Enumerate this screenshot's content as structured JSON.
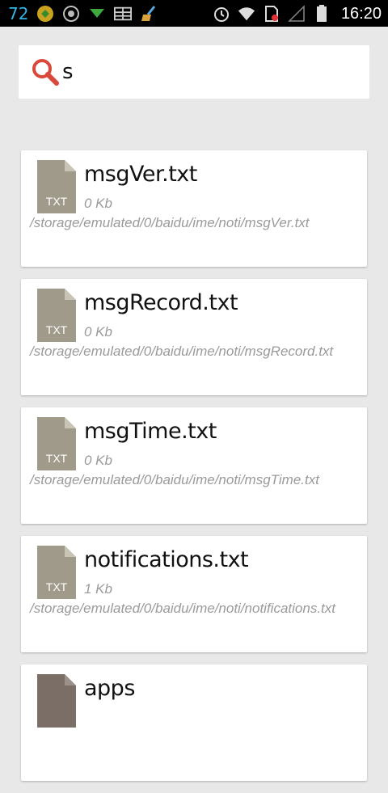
{
  "status_bar": {
    "battery_number": "72",
    "time": "16:20",
    "icons_left": [
      "circle-logo-icon",
      "target-icon",
      "download-icon",
      "grid-icon",
      "broom-icon"
    ],
    "icons_right": [
      "alarm-icon",
      "wifi-icon",
      "sim-icon",
      "signal-icon",
      "battery-icon"
    ],
    "colors": {
      "battery_number": "#33b5e5"
    }
  },
  "search": {
    "query": "s",
    "icon": "search-icon",
    "icon_color": "#d9483b"
  },
  "files": [
    {
      "name": "msgVer.txt",
      "size": "0 Kb",
      "path": "/storage/emulated/0/baidu/ime/noti/msgVer.txt",
      "type_label": "TXT"
    },
    {
      "name": "msgRecord.txt",
      "size": "0 Kb",
      "path": "/storage/emulated/0/baidu/ime/noti/msgRecord.txt",
      "type_label": "TXT"
    },
    {
      "name": "msgTime.txt",
      "size": "0 Kb",
      "path": "/storage/emulated/0/baidu/ime/noti/msgTime.txt",
      "type_label": "TXT"
    },
    {
      "name": "notifications.txt",
      "size": "1 Kb",
      "path": "/storage/emulated/0/baidu/ime/noti/notifications.txt",
      "type_label": "TXT"
    },
    {
      "name": "apps",
      "size": "",
      "path": "",
      "type_label": ""
    }
  ],
  "colors": {
    "background": "#e8e8e8",
    "file_icon": "#a09a8a",
    "folder_icon": "#7a6e66"
  }
}
